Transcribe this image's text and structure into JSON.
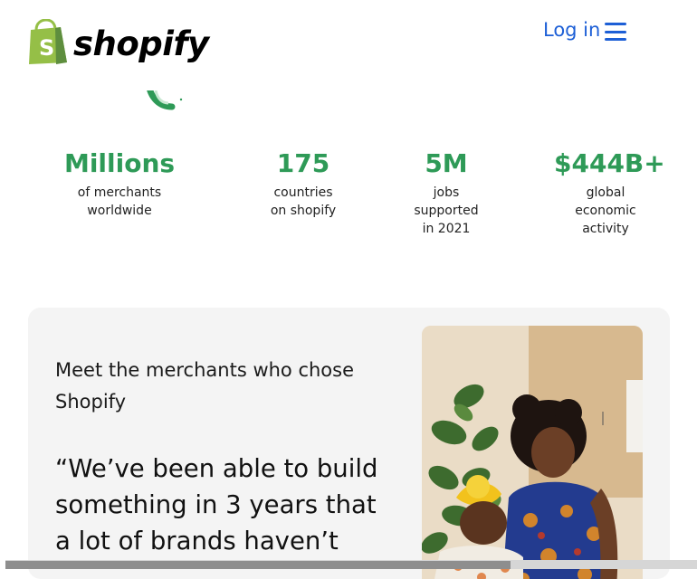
{
  "header": {
    "logo_text": "shopify",
    "login_label": "Log in",
    "menu_icon": "hamburger-menu-icon"
  },
  "stats": [
    {
      "value": "Millions",
      "label": "of merchants worldwide"
    },
    {
      "value": "175",
      "label": "countries on shopify"
    },
    {
      "value": "5M",
      "label": "jobs supported in 2021"
    },
    {
      "value": "$444B+",
      "label": "global economic activity"
    }
  ],
  "merchant_section": {
    "heading": "Meet the merchants who chose Shopify",
    "quote": "“We’ve been able to build something in 3 years that a lot of brands haven’t"
  },
  "colors": {
    "brand_green": "#95bf47",
    "stat_green": "#2e9a57",
    "link_blue": "#1d5fd6",
    "card_bg": "#f4f4f4"
  }
}
